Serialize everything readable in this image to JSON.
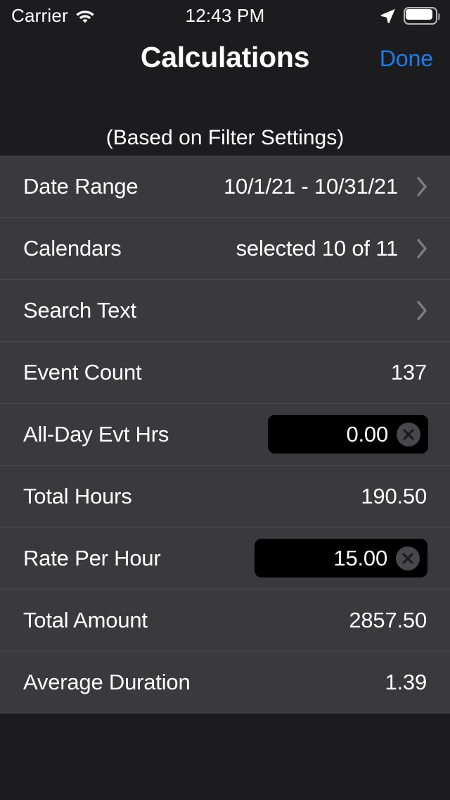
{
  "status_bar": {
    "carrier": "Carrier",
    "wifi_icon": "wifi-icon",
    "time": "12:43 PM",
    "location_icon": "location-arrow-icon",
    "battery_icon": "battery-icon"
  },
  "nav_bar": {
    "title": "Calculations",
    "done_label": "Done",
    "done_color": "#1a7ced"
  },
  "section": {
    "header": "(Based on Filter Settings)"
  },
  "rows": [
    {
      "label": "Date Range",
      "value": "10/1/21 - 10/31/21",
      "type": "disclosure",
      "chevron": "chevron-right-icon"
    },
    {
      "label": "Calendars",
      "value": "selected 10 of 11",
      "type": "disclosure",
      "chevron": "chevron-right-icon"
    },
    {
      "label": "Search Text",
      "value": "",
      "type": "disclosure",
      "chevron": "chevron-right-icon"
    },
    {
      "label": "Event Count",
      "value": "137",
      "type": "value"
    },
    {
      "label": "All-Day Evt Hrs",
      "value": "0.00",
      "type": "field",
      "clear_icon": "clear-circle-icon"
    },
    {
      "label": "Total Hours",
      "value": "190.50",
      "type": "value"
    },
    {
      "label": "Rate Per Hour",
      "value": "15.00",
      "type": "field",
      "clear_icon": "clear-circle-icon"
    },
    {
      "label": "Total Amount",
      "value": "2857.50",
      "type": "value"
    },
    {
      "label": "Average Duration",
      "value": "1.39",
      "type": "value"
    }
  ],
  "colors": {
    "background": "#1c1c1e",
    "row_background": "#3a3a3d",
    "separator": "#4d4d52",
    "field_background": "#000000",
    "accent": "#1a7ced",
    "text": "#ffffff",
    "chevron": "#7b7b80"
  }
}
